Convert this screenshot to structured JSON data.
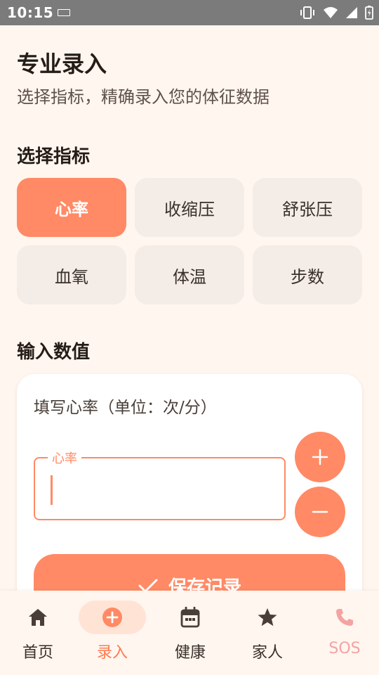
{
  "status_bar": {
    "time": "10:15"
  },
  "header": {
    "title": "专业录入",
    "subtitle": "选择指标，精确录入您的体征数据"
  },
  "metrics_section": {
    "title": "选择指标",
    "selected": "心率",
    "items": [
      "心率",
      "收缩压",
      "舒张压",
      "血氧",
      "体温",
      "步数"
    ]
  },
  "input_section": {
    "title": "输入数值",
    "prompt": "填写心率（单位：次/分）",
    "field_label": "心率",
    "field_value": "",
    "save_label": "保存记录"
  },
  "bottom_nav": {
    "active": "录入",
    "items": [
      {
        "label": "首页",
        "icon": "home-icon"
      },
      {
        "label": "录入",
        "icon": "add-circle-icon"
      },
      {
        "label": "健康",
        "icon": "calendar-icon"
      },
      {
        "label": "家人",
        "icon": "star-icon"
      },
      {
        "label": "SOS",
        "icon": "phone-icon"
      }
    ]
  },
  "colors": {
    "accent": "#FF8A65",
    "background": "#FFF6EF",
    "chip_background": "#F3ECE7",
    "sos": "#F4A3A3"
  }
}
